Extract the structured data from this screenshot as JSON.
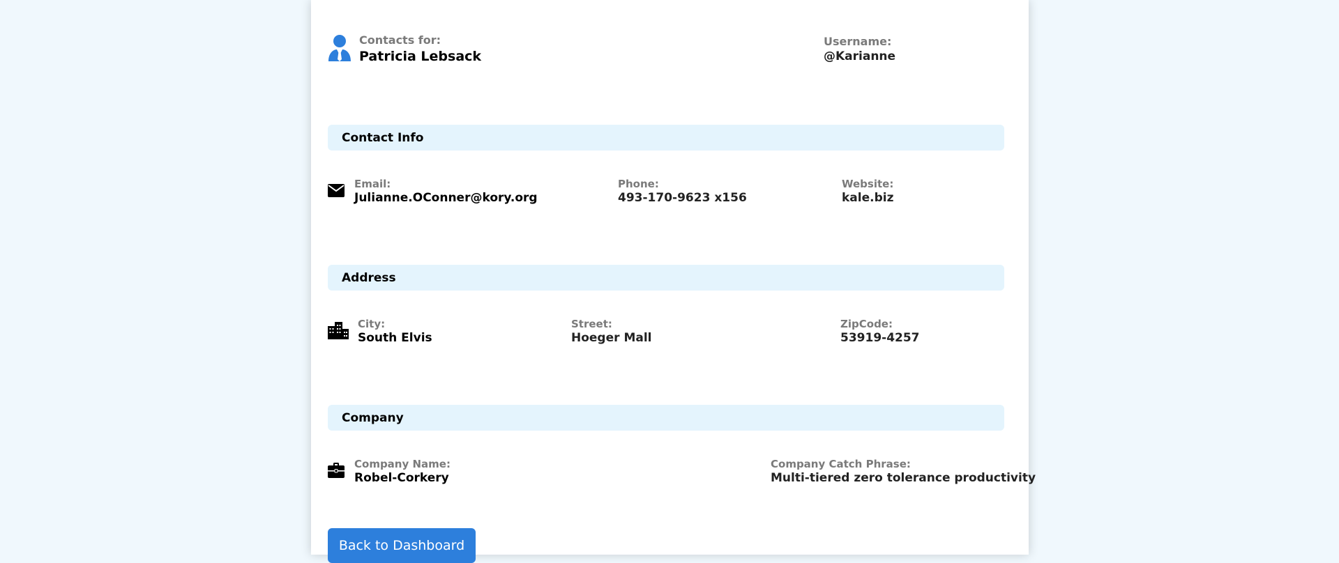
{
  "header": {
    "contacts_for_label": "Contacts for:",
    "contact_name": "Patricia Lebsack",
    "username_label": "Username:",
    "username_value": "@Karianne"
  },
  "contact_info": {
    "title": "Contact Info",
    "email_label": "Email:",
    "email_value": "Julianne.OConner@kory.org",
    "phone_label": "Phone:",
    "phone_value": "493-170-9623 x156",
    "website_label": "Website:",
    "website_value": "kale.biz"
  },
  "address": {
    "title": "Address",
    "city_label": "City:",
    "city_value": "South Elvis",
    "street_label": "Street:",
    "street_value": "Hoeger Mall",
    "zip_label": "ZipCode:",
    "zip_value": "53919-4257"
  },
  "company": {
    "title": "Company",
    "name_label": "Company Name:",
    "name_value": "Robel-Corkery",
    "catch_label": "Company Catch Phrase:",
    "catch_value": "Multi-tiered zero tolerance productivity"
  },
  "actions": {
    "back_label": "Back to Dashboard"
  },
  "icons": {
    "user": "user-tie-icon",
    "email": "envelope-icon",
    "address": "city-icon",
    "company": "briefcase-icon"
  },
  "colors": {
    "accent": "#2d7fdc",
    "section_bg": "#e4f4fd",
    "page_bg": "#f0f8fd",
    "label": "#7a7a7a"
  }
}
